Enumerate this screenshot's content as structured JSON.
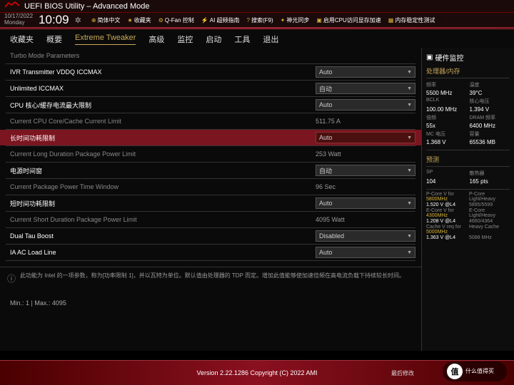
{
  "header": {
    "brand": "ROG",
    "title": "UEFI BIOS Utility – Advanced Mode",
    "date": "10/17/2022",
    "day": "Monday",
    "time": "10:09"
  },
  "toolbar": [
    {
      "icon": "⊕",
      "label": "简体中文"
    },
    {
      "icon": "★",
      "label": "收藏夹"
    },
    {
      "icon": "⚙",
      "label": "Q-Fan 控制"
    },
    {
      "icon": "⚡",
      "label": "AI 超频指南"
    },
    {
      "icon": "?",
      "label": "搜索(F9)"
    },
    {
      "icon": "✦",
      "label": "神光同步"
    },
    {
      "icon": "▣",
      "label": "启用CPU访问显存加速"
    },
    {
      "icon": "▦",
      "label": "内存稳定性测试"
    }
  ],
  "tabs": [
    "收藏夹",
    "概要",
    "Extreme Tweaker",
    "高级",
    "监控",
    "启动",
    "工具",
    "退出"
  ],
  "active_tab": 2,
  "section_header": "Turbo Mode Parameters",
  "rows": [
    {
      "type": "opt",
      "label": "IVR Transmitter VDDQ ICCMAX",
      "ctrl": "select",
      "value": "Auto"
    },
    {
      "type": "opt",
      "label": "Unlimited ICCMAX",
      "ctrl": "select",
      "value": "自动"
    },
    {
      "type": "opt",
      "label": "CPU 核心/缓存电流最大限制",
      "ctrl": "select",
      "value": "Auto"
    },
    {
      "type": "head",
      "label": "Current CPU Core/Cache Current Limit",
      "value": "511.75 A"
    },
    {
      "type": "opt",
      "label": "长时间功耗限制",
      "ctrl": "select",
      "value": "Auto",
      "selected": true
    },
    {
      "type": "head",
      "label": "Current Long Duration Package Power Limit",
      "value": "253 Watt"
    },
    {
      "type": "opt",
      "label": "电源时间窗",
      "ctrl": "select",
      "value": "自动"
    },
    {
      "type": "head",
      "label": "Current Package Power Time Window",
      "value": "96 Sec"
    },
    {
      "type": "opt",
      "label": "短时间功耗限制",
      "ctrl": "select",
      "value": "Auto"
    },
    {
      "type": "head",
      "label": "Current Short Duration Package Power Limit",
      "value": "4095 Watt"
    },
    {
      "type": "opt",
      "label": "Dual Tau Boost",
      "ctrl": "select",
      "value": "Disabled"
    },
    {
      "type": "opt",
      "label": "IA AC Load Line",
      "ctrl": "select",
      "value": "Auto"
    }
  ],
  "help": {
    "text": "此功能为 Intel 的一项参数，称为[功率限制 1]，并以瓦特为单位。默认值由处理器的 TDP 而定。增加此值能够使加速倍频在高电流负载下持续较长时间。",
    "minmax": "Min.: 1     |     Max.: 4095"
  },
  "monitor": {
    "title": "硬件监控",
    "sub1": "处理器/内存",
    "grid1": [
      [
        "频率",
        "温度"
      ],
      [
        "5500 MHz",
        "39°C"
      ],
      [
        "BCLK",
        "核心电压"
      ],
      [
        "100.00 MHz",
        "1.394 V"
      ],
      [
        "倍频",
        "DRAM 频率"
      ],
      [
        "55x",
        "6400 MHz"
      ],
      [
        "MC 电压",
        "容量"
      ],
      [
        "1.368 V",
        "65536 MB"
      ]
    ],
    "sub2": "预测",
    "grid2": [
      [
        "SP",
        "散热器"
      ],
      [
        "104",
        "165 pts"
      ]
    ],
    "cores": [
      {
        "l": "P-Core V for",
        "v": "5800MHz",
        "c": "#d4af37"
      },
      {
        "l": "1.520 V @L4",
        "v": "",
        "c": "#fff"
      },
      {
        "l": "E-Core V for",
        "v": "4300MHz",
        "c": "#d4af37"
      },
      {
        "l": "1.208 V @L4",
        "v": "",
        "c": "#fff"
      },
      {
        "l": "Cache V req for",
        "v": "5000MHz",
        "c": "#d4af37"
      },
      {
        "l": "1.363 V @L4",
        "v": "",
        "c": "#fff"
      }
    ],
    "cores_r": [
      "P-Core Light/Heavy",
      "5895/5599",
      "E-Core Light/Heavy",
      "4660/4364",
      "Heavy Cache",
      "5088 MHz"
    ]
  },
  "footer": {
    "lastmod": "最后修改",
    "version": "Version 2.22.1286 Copyright (C) 2022 AMI"
  },
  "watermark": {
    "char": "值",
    "text": "什么值得买"
  }
}
